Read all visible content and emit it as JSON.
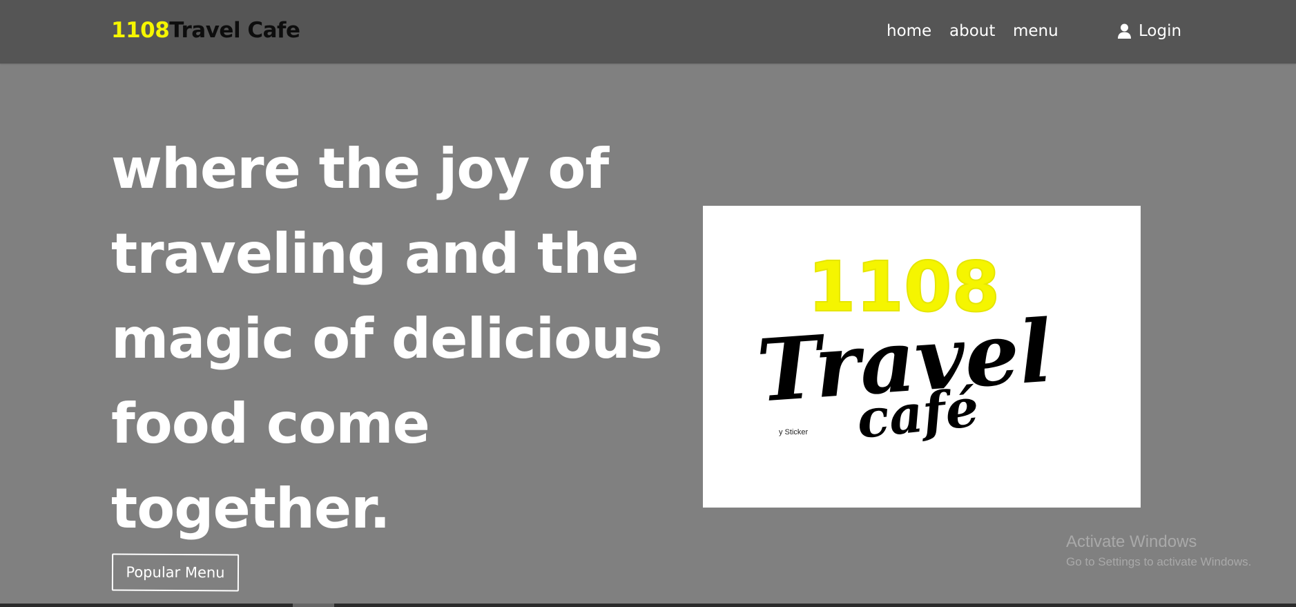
{
  "brand": {
    "number": "1108",
    "name": "Travel Cafe",
    "number_color": "#f5f500"
  },
  "nav": {
    "links": [
      {
        "label": "home"
      },
      {
        "label": "about"
      },
      {
        "label": "menu"
      }
    ],
    "login": {
      "label": "Login",
      "icon": "user-icon"
    }
  },
  "hero": {
    "headline": "where the joy of traveling and the magic of delicious food come together.",
    "cta_label": "Popular Menu",
    "logo": {
      "number": "1108",
      "line1": "Travel",
      "line2": "café",
      "caption": "y Sticker"
    }
  },
  "watermark": {
    "title": "Activate Windows",
    "subtitle": "Go to Settings to activate Windows."
  },
  "colors": {
    "background": "#808080",
    "navbar": "#555555",
    "accent_yellow": "#f5f500"
  }
}
